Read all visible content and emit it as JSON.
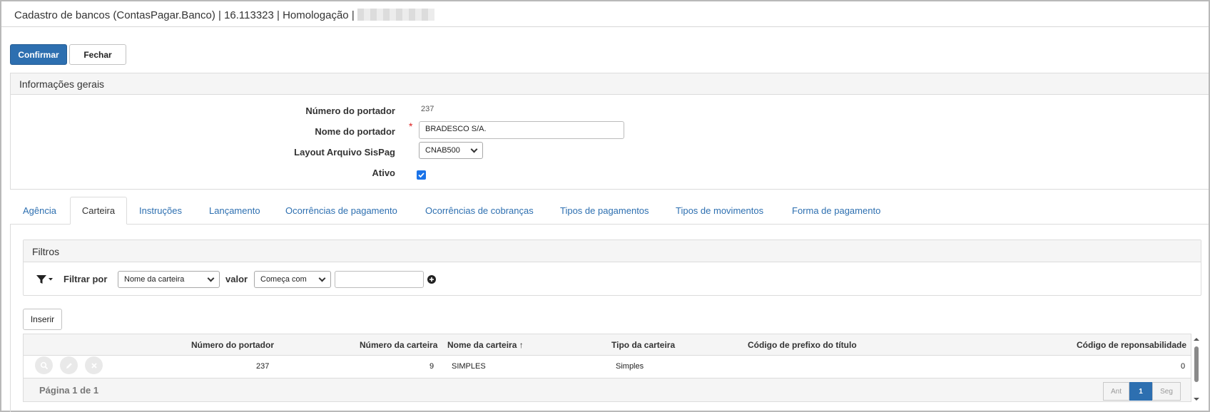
{
  "window": {
    "title": "Cadastro de bancos (ContasPagar.Banco) | 16.113323 | Homologação |"
  },
  "toolbar": {
    "confirm_label": "Confirmar",
    "close_label": "Fechar"
  },
  "general": {
    "header": "Informações gerais",
    "portador_number_label": "Número do portador",
    "portador_number_value": "237",
    "portador_name_label": "Nome do portador",
    "portador_name_value": "BRADESCO S/A.",
    "layout_label": "Layout Arquivo SisPag",
    "layout_value": "CNAB500",
    "active_label": "Ativo",
    "active_checked": true,
    "required_mark": "*"
  },
  "tabs": [
    {
      "label": "Agência"
    },
    {
      "label": "Carteira"
    },
    {
      "label": "Instruções"
    },
    {
      "label": "Lançamento"
    },
    {
      "label": "Ocorrências de pagamento"
    },
    {
      "label": "Ocorrências de cobranças"
    },
    {
      "label": "Tipos de pagamentos"
    },
    {
      "label": "Tipos de movimentos"
    },
    {
      "label": "Forma de pagamento"
    }
  ],
  "active_tab": "Carteira",
  "filters": {
    "header": "Filtros",
    "filter_by_label": "Filtrar por",
    "filter_field_value": "Nome da carteira",
    "value_label": "valor",
    "operator_value": "Começa com",
    "search_value": ""
  },
  "insert_label": "Inserir",
  "grid": {
    "columns": [
      {
        "label": "Número do portador"
      },
      {
        "label": "Número da carteira"
      },
      {
        "label": "Nome da carteira"
      },
      {
        "label": "Tipo da carteira"
      },
      {
        "label": "Código de prefixo do título"
      },
      {
        "label": "Código de reponsabilidade"
      }
    ],
    "sort_indicator": "↑",
    "rows": [
      {
        "portador": "237",
        "carteira_num": "9",
        "carteira_nome": "SIMPLES",
        "tipo": "Simples",
        "prefixo": "",
        "responsabilidade": "0"
      }
    ],
    "footer": {
      "page_text": "Página 1 de 1",
      "prev_label": "Ant",
      "current_page": "1",
      "next_label": "Seg"
    }
  },
  "colors": {
    "primary": "#2d6fb0",
    "link": "#2d6fb0",
    "required": "#dd2222",
    "checkbox": "#1a73e8"
  }
}
